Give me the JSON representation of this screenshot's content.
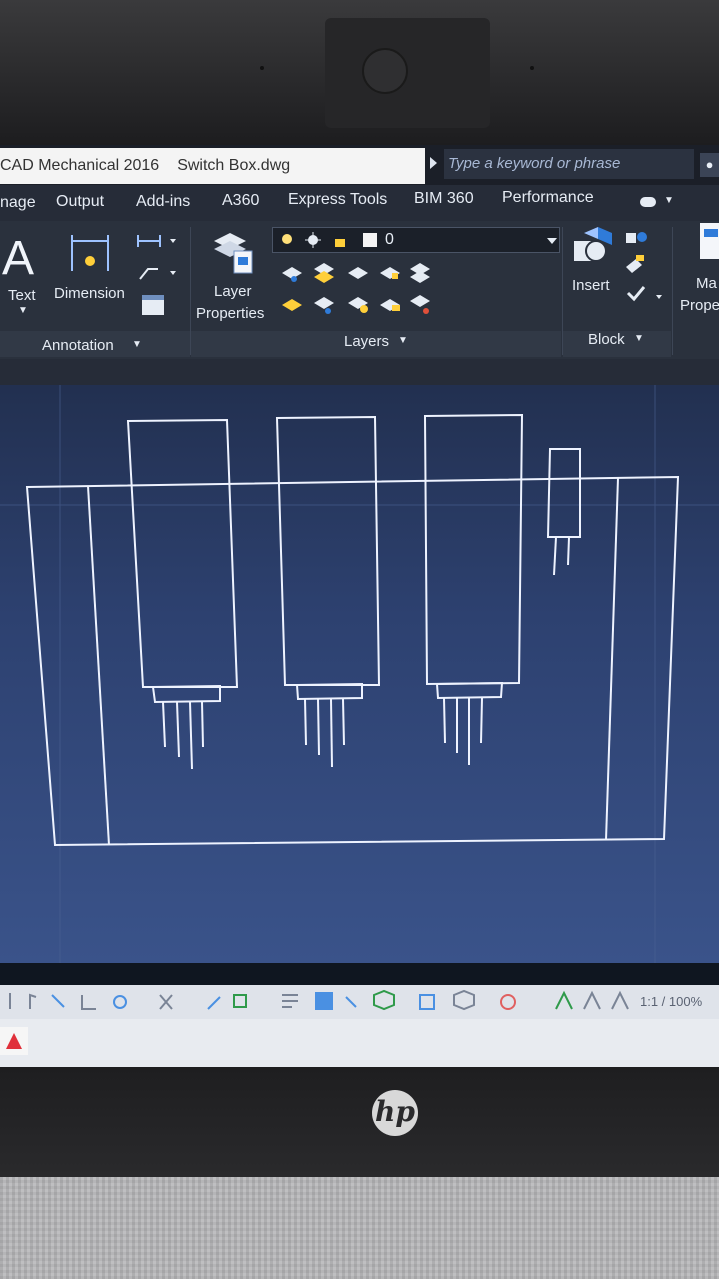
{
  "title_bar": {
    "app_title": "CAD Mechanical 2016",
    "file_name": "Switch Box.dwg",
    "search_placeholder": "Type a keyword or phrase"
  },
  "menu": {
    "items": [
      "nage",
      "Output",
      "Add-ins",
      "A360",
      "Express Tools",
      "BIM 360",
      "Performance"
    ]
  },
  "ribbon": {
    "annotation": {
      "text_label": "Text",
      "dimension_label": "Dimension",
      "panel_label": "Annotation"
    },
    "layers": {
      "properties_line1": "Layer",
      "properties_line2": "Properties",
      "current_layer": "0",
      "panel_label": "Layers"
    },
    "block": {
      "insert_label": "Insert",
      "panel_label": "Block"
    },
    "match": {
      "line1": "Ma",
      "line2": "Prope"
    }
  },
  "status": {
    "zoom": "1:1 / 100%"
  },
  "colors": {
    "canvas_top": "#223050",
    "canvas_bottom": "#3a538a",
    "ribbon_bg": "#2a313d"
  }
}
